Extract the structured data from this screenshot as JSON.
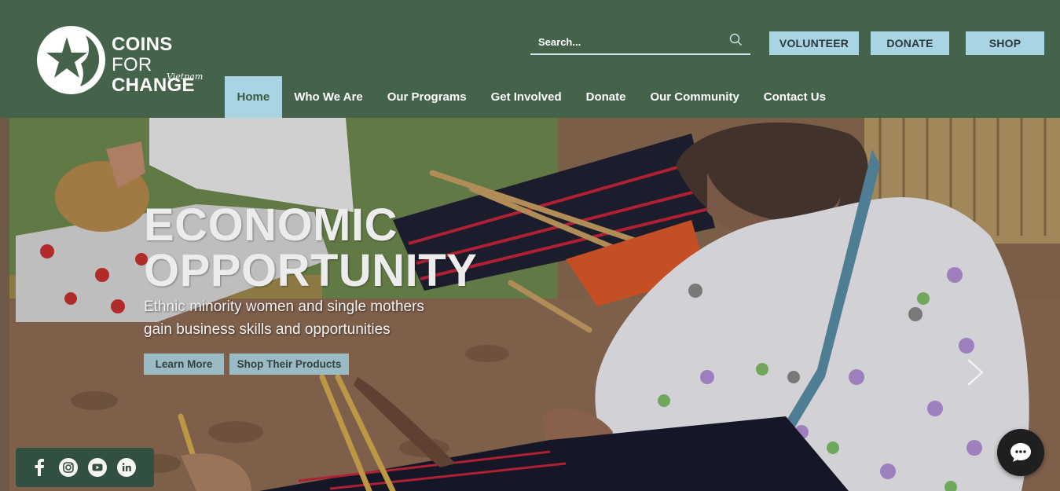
{
  "brand": {
    "name_line1_bold": "COINS",
    "name_line1_light": " FOR",
    "name_line2": "CHANGE",
    "subtitle": "Vietnam",
    "logo_icon": "star-icon"
  },
  "search": {
    "placeholder": "Search...",
    "icon": "search-icon"
  },
  "top_buttons": {
    "volunteer": "VOLUNTEER",
    "donate": "DONATE",
    "shop": "SHOP"
  },
  "nav": {
    "items": [
      {
        "label": "Home",
        "active": true
      },
      {
        "label": "Who We Are"
      },
      {
        "label": "Our Programs"
      },
      {
        "label": "Get Involved"
      },
      {
        "label": "Donate"
      },
      {
        "label": "Our Community"
      },
      {
        "label": "Contact Us"
      }
    ]
  },
  "hero": {
    "title_line1": "ECONOMIC",
    "title_line2": "OPPORTUNITY",
    "subtitle_line1": "Ethnic minority women and single mothers",
    "subtitle_line2": "gain business skills and opportunities",
    "learn_more": "Learn More",
    "shop_products": "Shop Their Products"
  },
  "social": [
    "facebook-icon",
    "instagram-icon",
    "youtube-icon",
    "linkedin-icon"
  ],
  "colors": {
    "header_bg": "#44634a",
    "accent_light_blue": "#a8d4e3",
    "text_white": "#ffffff"
  }
}
